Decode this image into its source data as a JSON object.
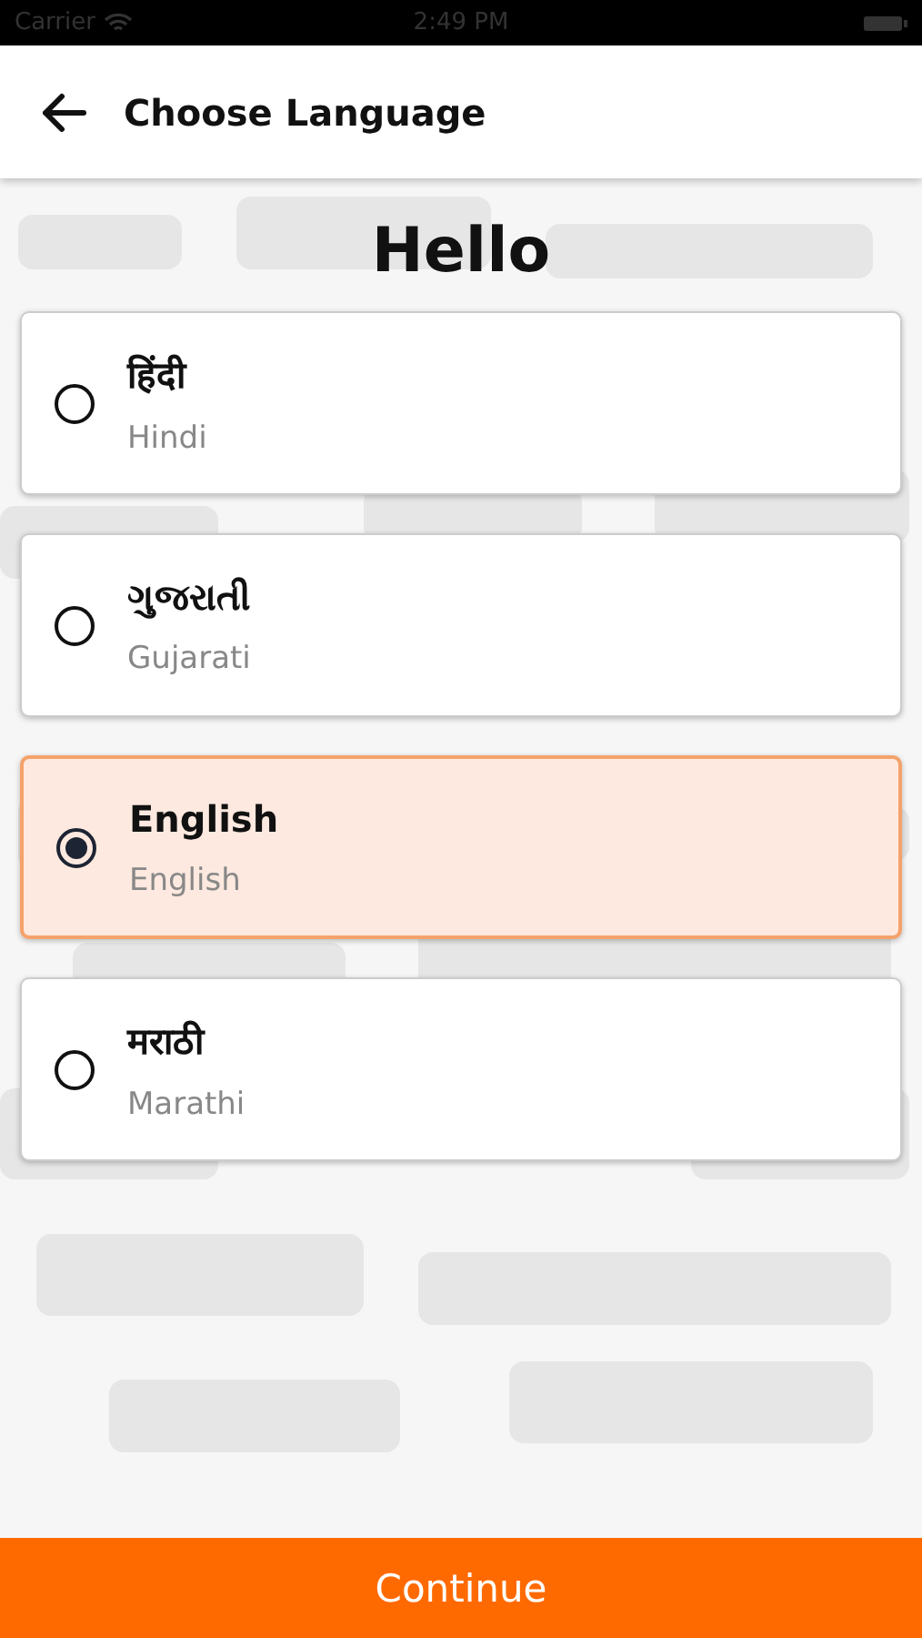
{
  "status_bar": {
    "carrier": "Carrier",
    "time": "2:49 PM"
  },
  "header": {
    "title": "Choose Language"
  },
  "greeting": "Hello",
  "languages": [
    {
      "native": "हिंदी",
      "english": "Hindi",
      "selected": false
    },
    {
      "native": "ગુજરાતી",
      "english": "Gujarati",
      "selected": false
    },
    {
      "native": "English",
      "english": "English",
      "selected": true
    },
    {
      "native": "मराठी",
      "english": "Marathi",
      "selected": false
    }
  ],
  "continue_button": "Continue"
}
